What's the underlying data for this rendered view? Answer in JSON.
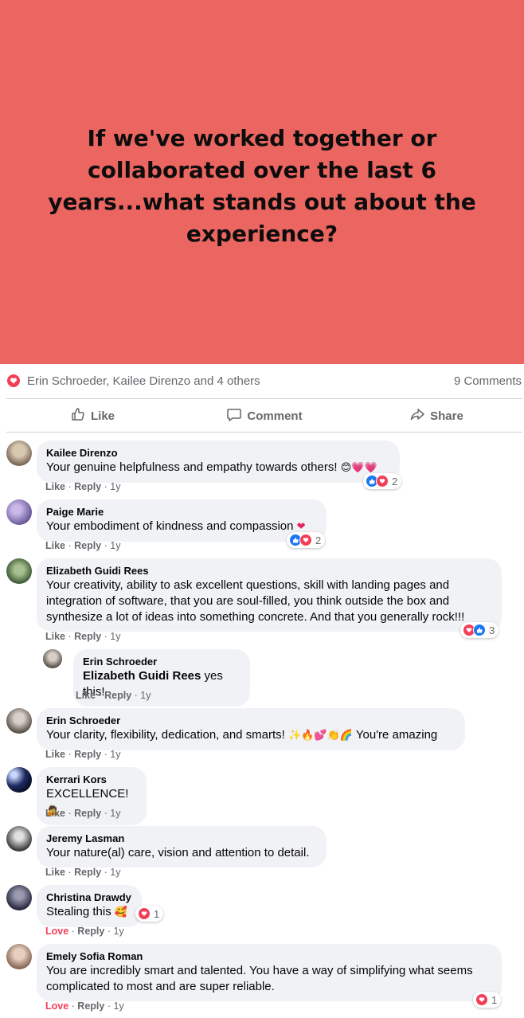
{
  "post": {
    "banner_text": "If we've worked together or collaborated over the last 6 years...what stands out about the experience?",
    "reaction_names": "Erin Schroeder, Kailee Direnzo and 4 others",
    "comment_count": "9 Comments",
    "actions": {
      "like": "Like",
      "comment": "Comment",
      "share": "Share"
    }
  },
  "comments": [
    {
      "author": "Kailee Direnzo",
      "text": "Your genuine helpfulness and empathy towards others!",
      "emoji": "😊💗💗",
      "meta": {
        "like": "Like",
        "reply": "Reply",
        "time": "1y"
      },
      "reaction_count": "2"
    },
    {
      "author": "Paige Marie",
      "text": "Your embodiment of kindness and compassion",
      "emoji": "❤",
      "meta": {
        "like": "Like",
        "reply": "Reply",
        "time": "1y"
      },
      "reaction_count": "2"
    },
    {
      "author": "Elizabeth Guidi Rees",
      "text": "Your creativity, ability to ask excellent questions, skill with landing pages and integration of software, that you are soul-filled, you think outside the box and synthesize a lot of ideas into something concrete. And that you generally rock!!!",
      "meta": {
        "like": "Like",
        "reply": "Reply",
        "time": "1y"
      },
      "reaction_count": "3"
    },
    {
      "author": "Erin Schroeder",
      "mention": "Elizabeth Guidi Rees",
      "text": " yes this!",
      "meta": {
        "like": "Like",
        "reply": "Reply",
        "time": "1y"
      }
    },
    {
      "author": "Erin Schroeder",
      "text": "Your clarity, flexibility, dedication, and smarts!",
      "emoji": "✨🔥💕👏🌈",
      "text_after": "You're amazing",
      "meta": {
        "like": "Like",
        "reply": "Reply",
        "time": "1y"
      }
    },
    {
      "author": "Kerrari Kors",
      "text": "EXCELLENCE!",
      "emoji": "🙇",
      "meta": {
        "like": "Like",
        "reply": "Reply",
        "time": "1y"
      }
    },
    {
      "author": "Jeremy Lasman",
      "text": "Your nature(al) care, vision and attention to detail.",
      "meta": {
        "like": "Like",
        "reply": "Reply",
        "time": "1y"
      }
    },
    {
      "author": "Christina Drawdy",
      "text": "Stealing this",
      "emoji": "🥰",
      "meta": {
        "like": "Love",
        "reply": "Reply",
        "time": "1y"
      },
      "reaction_count": "1"
    },
    {
      "author": "Emely Sofia Roman",
      "text": "You are incredibly smart and talented. You have a way of simplifying what seems complicated to most and are super reliable.",
      "meta": {
        "like": "Love",
        "reply": "Reply",
        "time": "1y"
      },
      "reaction_count": "1"
    }
  ],
  "colors": {
    "banner": "#ec6661",
    "bubble": "#f0f2f5",
    "love": "#f33e58",
    "like": "#1877f2",
    "muted": "#65676b"
  },
  "icons": {
    "heart": "heart-icon",
    "thumbs_up": "thumbs-up-icon",
    "comment": "comment-icon",
    "share": "share-icon"
  }
}
